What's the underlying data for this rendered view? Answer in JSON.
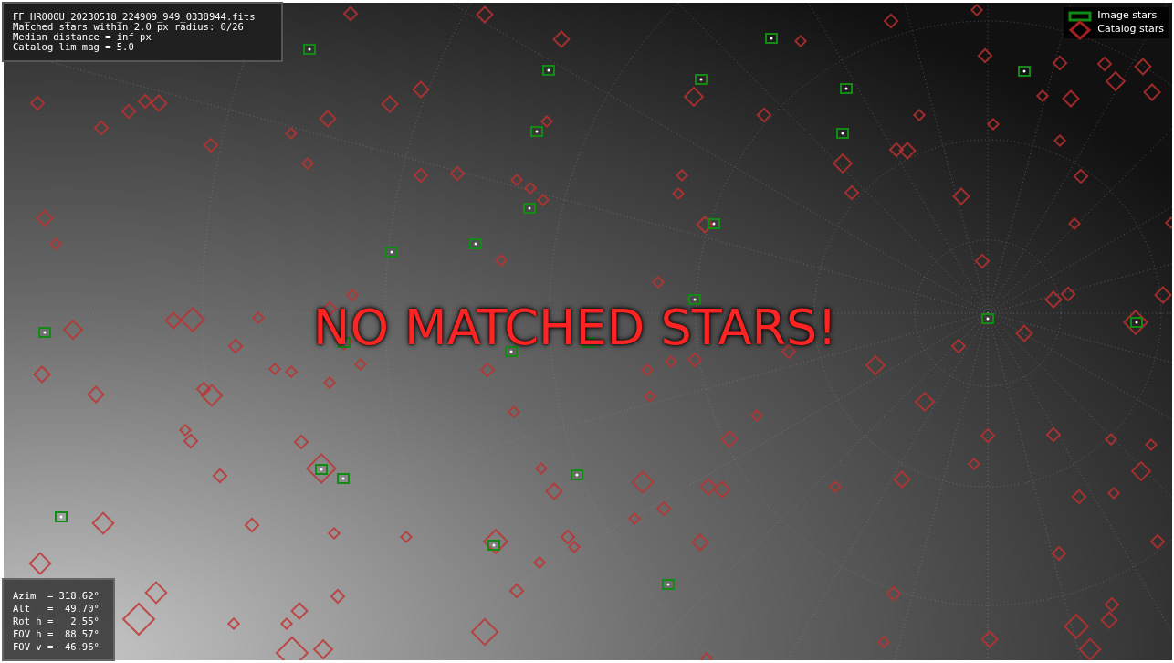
{
  "info_box": {
    "lines": [
      "FF_HR000U_20230518_224909_949_0338944.fits",
      "Matched stars within 2.0 px radius: 0/26",
      "Median distance = inf px",
      "Catalog lim mag = 5.0"
    ]
  },
  "legend": {
    "items": [
      {
        "kind": "image",
        "label": "Image stars"
      },
      {
        "kind": "catalog",
        "label": "Catalog stars"
      }
    ]
  },
  "overlay_message": "NO MATCHED STARS!",
  "pointing_box": {
    "lines": [
      "Azim  = 318.62°",
      "Alt   =  49.70°",
      "Rot h =   2.55°",
      "FOV h =  88.57°",
      "FOV v =  46.96°"
    ]
  }
}
